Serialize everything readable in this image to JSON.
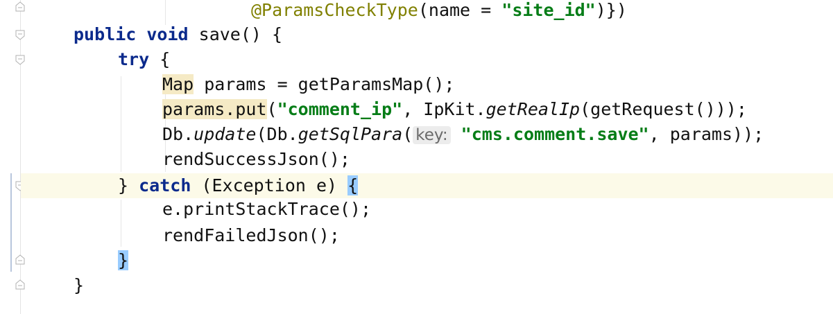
{
  "code": {
    "line1": {
      "annotation": "@ParamsCheckType",
      "open": "(",
      "param": "name",
      "eq": " = ",
      "value": "\"site_id\"",
      "close": ")})"
    },
    "line2": {
      "kw1": "public",
      "kw2": "void",
      "method": "save() {"
    },
    "line3": {
      "kw": "try",
      "rest": " {"
    },
    "line4": {
      "type": "Map",
      "rest": " params = getParamsMap();"
    },
    "line5": {
      "obj": "params.put",
      "open": "(",
      "str": "\"comment_ip\"",
      "mid": ", IpKit.",
      "call": "getRealIp",
      "rest": "(getRequest()));"
    },
    "line6": {
      "cls": "Db.",
      "call1": "update",
      "mid": "(Db.",
      "call2": "getSqlPara",
      "open": "(",
      "hint": "key:",
      "str": "\"cms.comment.save\"",
      "rest": ", params));"
    },
    "line7": {
      "text": "rendSuccessJson();"
    },
    "line8": {
      "open": "} ",
      "kw": "catch",
      "mid": " (Exception e) ",
      "brace": "{"
    },
    "line9": {
      "text": "e.printStackTrace();"
    },
    "line10": {
      "text": "rendFailedJson();"
    },
    "line11": {
      "brace": "}"
    },
    "line12": {
      "brace": "}"
    }
  },
  "colors": {
    "keyword": "#0b2a8c",
    "string": "#067d17",
    "annotation": "#808000",
    "current_line": "#fcfae8",
    "brace_match": "#99ccff"
  },
  "icons": [
    "fold-end-icon",
    "fold-start-icon"
  ]
}
